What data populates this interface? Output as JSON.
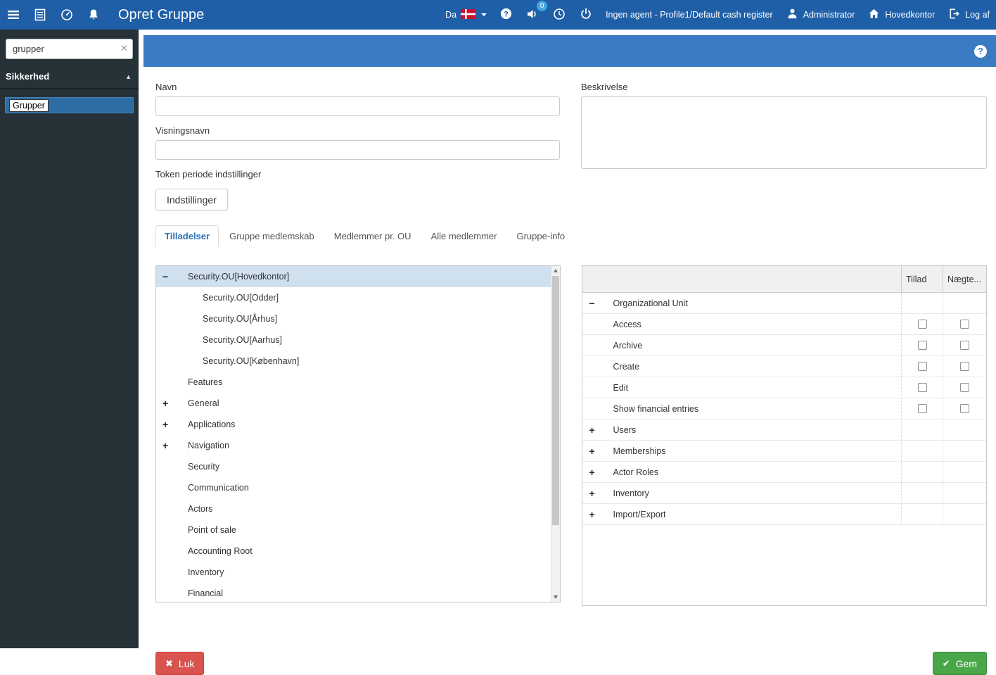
{
  "topbar": {
    "title": "Opret Gruppe",
    "language": "Da",
    "badge_count": "0",
    "agent_status": "Ingen agent - Profile1/Default cash register",
    "user": "Administrator",
    "office": "Hovedkontor",
    "logout_label": "Log af"
  },
  "sidebar": {
    "search_value": "grupper",
    "section_label": "Sikkerhed",
    "selected_item": "Grupper"
  },
  "form": {
    "name_label": "Navn",
    "name_value": "",
    "display_name_label": "Visningsnavn",
    "display_name_value": "",
    "token_label": "Token periode indstillinger",
    "settings_button": "Indstillinger",
    "description_label": "Beskrivelse",
    "description_value": ""
  },
  "tabs": [
    {
      "label": "Tilladelser",
      "active": true
    },
    {
      "label": "Gruppe medlemskab",
      "active": false
    },
    {
      "label": "Medlemmer pr. OU",
      "active": false
    },
    {
      "label": "Alle medlemmer",
      "active": false
    },
    {
      "label": "Gruppe-info",
      "active": false
    }
  ],
  "tree": {
    "items": [
      {
        "label": "Security.OU[Hovedkontor]",
        "expander": "-",
        "level": 0,
        "selected": true
      },
      {
        "label": "Security.OU[Odder]",
        "expander": null,
        "level": 1,
        "selected": false
      },
      {
        "label": "Security.OU[Århus]",
        "expander": null,
        "level": 1,
        "selected": false
      },
      {
        "label": "Security.OU[Aarhus]",
        "expander": null,
        "level": 1,
        "selected": false
      },
      {
        "label": "Security.OU[København]",
        "expander": null,
        "level": 1,
        "selected": false
      },
      {
        "label": "Features",
        "expander": null,
        "level": 0,
        "selected": false
      },
      {
        "label": "General",
        "expander": "+",
        "level": 0,
        "selected": false
      },
      {
        "label": "Applications",
        "expander": "+",
        "level": 0,
        "selected": false
      },
      {
        "label": "Navigation",
        "expander": "+",
        "level": 0,
        "selected": false
      },
      {
        "label": "Security",
        "expander": null,
        "level": 0,
        "selected": false
      },
      {
        "label": "Communication",
        "expander": null,
        "level": 0,
        "selected": false
      },
      {
        "label": "Actors",
        "expander": null,
        "level": 0,
        "selected": false
      },
      {
        "label": "Point of sale",
        "expander": null,
        "level": 0,
        "selected": false
      },
      {
        "label": "Accounting Root",
        "expander": null,
        "level": 0,
        "selected": false
      },
      {
        "label": "Inventory",
        "expander": null,
        "level": 0,
        "selected": false
      },
      {
        "label": "Financial",
        "expander": null,
        "level": 0,
        "selected": false
      }
    ]
  },
  "permissions": {
    "columns": [
      "Tillad",
      "Nægte..."
    ],
    "rows": [
      {
        "label": "Organizational Unit",
        "expander": "-",
        "group": true,
        "checkboxes": false
      },
      {
        "label": "Access",
        "expander": null,
        "group": false,
        "checkboxes": true
      },
      {
        "label": "Archive",
        "expander": null,
        "group": false,
        "checkboxes": true
      },
      {
        "label": "Create",
        "expander": null,
        "group": false,
        "checkboxes": true
      },
      {
        "label": "Edit",
        "expander": null,
        "group": false,
        "checkboxes": true
      },
      {
        "label": "Show financial entries",
        "expander": null,
        "group": false,
        "checkboxes": true
      },
      {
        "label": "Users",
        "expander": "+",
        "group": true,
        "checkboxes": false
      },
      {
        "label": "Memberships",
        "expander": "+",
        "group": true,
        "checkboxes": false
      },
      {
        "label": "Actor Roles",
        "expander": "+",
        "group": true,
        "checkboxes": false
      },
      {
        "label": "Inventory",
        "expander": "+",
        "group": true,
        "checkboxes": false
      },
      {
        "label": "Import/Export",
        "expander": "+",
        "group": true,
        "checkboxes": false
      }
    ]
  },
  "footer": {
    "close_button": "Luk",
    "save_button": "Gem"
  },
  "colors": {
    "topbar": "#1e5fa8",
    "content_header": "#3a7cc3",
    "sidebar": "#263238",
    "sidebar_selected": "#2e6da4",
    "tree_selected": "#cfe0ee",
    "tab_active_text": "#2a72b8",
    "danger": "#d9534f",
    "success": "#49a649",
    "badge": "#45a4e0",
    "flag_red": "#c8102e"
  }
}
